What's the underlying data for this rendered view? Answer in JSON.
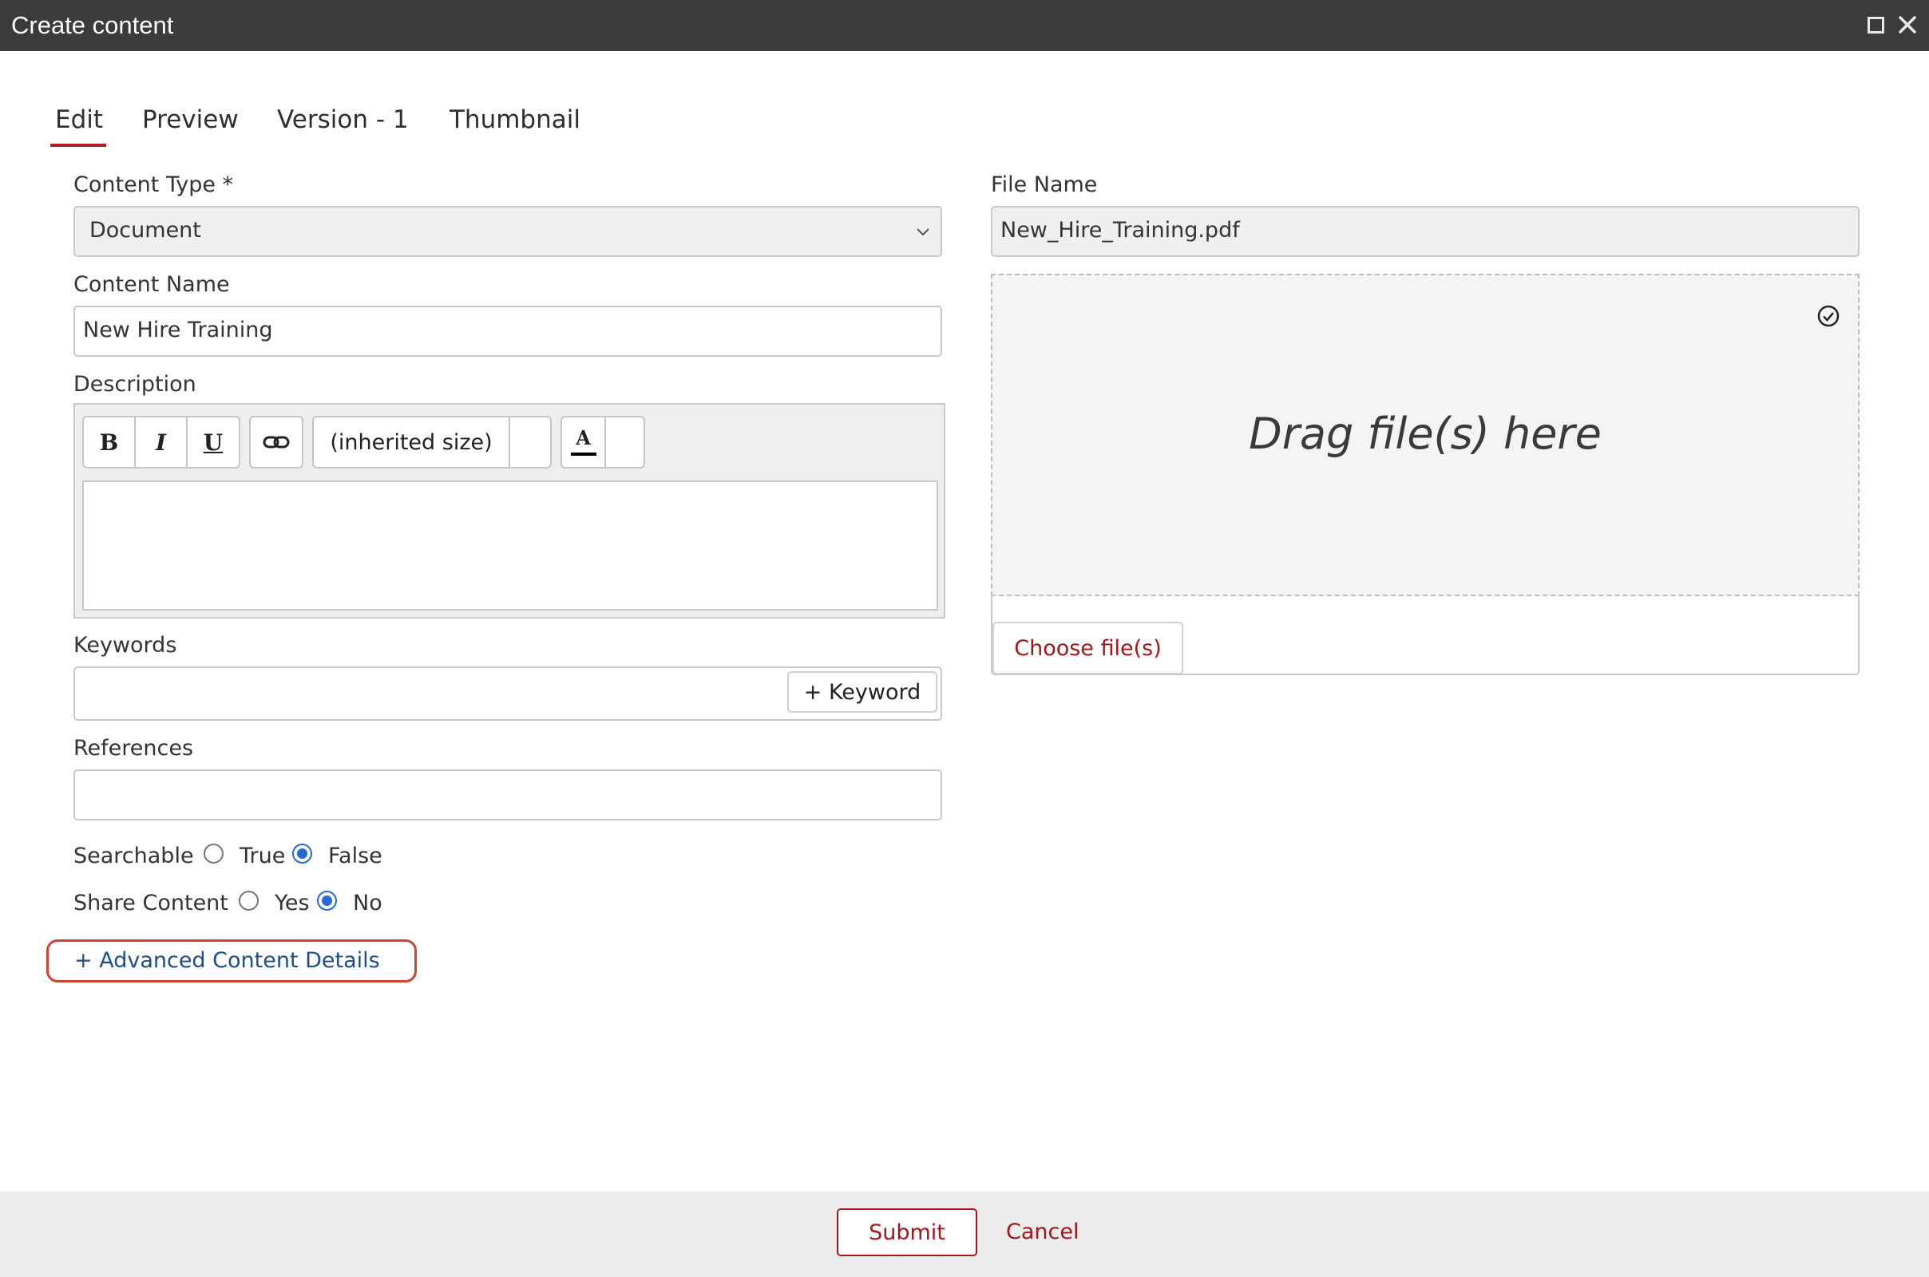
{
  "window": {
    "title": "Create content",
    "controls": {
      "maximize_icon": "maximize-icon",
      "close_icon": "close-icon"
    }
  },
  "tabs": [
    {
      "label": "Edit",
      "active": true
    },
    {
      "label": "Preview",
      "active": false
    },
    {
      "label": "Version - 1",
      "active": false
    },
    {
      "label": "Thumbnail",
      "active": false
    }
  ],
  "form": {
    "content_type": {
      "label": "Content Type *",
      "value": "Document"
    },
    "content_name": {
      "label": "Content Name",
      "value": "New Hire Training"
    },
    "description": {
      "label": "Description",
      "toolbar": {
        "bold": "B",
        "italic": "I",
        "underline": "U",
        "link_icon": "link-icon",
        "font_size": "(inherited size)",
        "font_color": "A"
      },
      "value": ""
    },
    "keywords": {
      "label": "Keywords",
      "add_button": "+ Keyword",
      "value": ""
    },
    "references": {
      "label": "References",
      "value": ""
    },
    "searchable": {
      "label": "Searchable",
      "options": [
        "True",
        "False"
      ],
      "selected": "False"
    },
    "share_content": {
      "label": "Share Content",
      "options": [
        "Yes",
        "No"
      ],
      "selected": "No"
    },
    "advanced_link": "+ Advanced Content Details"
  },
  "file": {
    "label": "File Name",
    "value": "New_Hire_Training.pdf",
    "dropzone_text": "Drag file(s) here",
    "choose_button": "Choose file(s)"
  },
  "footer": {
    "submit": "Submit",
    "cancel": "Cancel"
  },
  "colors": {
    "titlebar": "#3b3b3b",
    "accent": "#a4161a",
    "tab_underline": "#b21f24",
    "link": "#1f4d87",
    "radio_selected": "#2767d6",
    "highlight_outline": "#d4432f"
  }
}
